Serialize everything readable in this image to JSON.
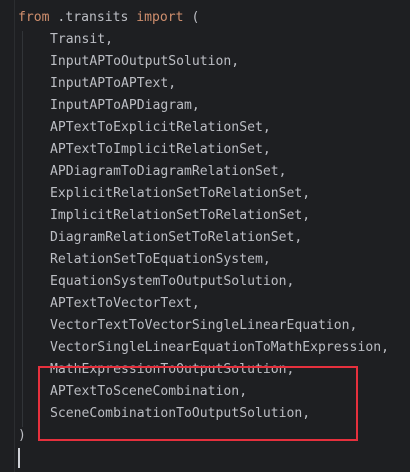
{
  "editor": {
    "import_line": {
      "keyword_from": "from",
      "module": " .transits ",
      "keyword_import": "import",
      "open_paren": " ("
    },
    "items": [
      "Transit,",
      "InputAPToOutputSolution,",
      "InputAPToAPText,",
      "InputAPToAPDiagram,",
      "APTextToExplicitRelationSet,",
      "APTextToImplicitRelationSet,",
      "APDiagramToDiagramRelationSet,",
      "ExplicitRelationSetToRelationSet,",
      "ImplicitRelationSetToRelationSet,",
      "DiagramRelationSetToRelationSet,",
      "RelationSetToEquationSystem,",
      "EquationSystemToOutputSolution,",
      "APTextToVectorText,",
      "VectorTextToVectorSingleLinearEquation,",
      "VectorSingleLinearEquationToMathExpression,",
      "MathExpressionToOutputSolution,",
      "APTextToSceneCombination,",
      "SceneCombinationToOutputSolution,"
    ],
    "close_paren": ")",
    "highlight_color": "#e6303d",
    "keyword_color": "#cf8e6d",
    "text_color": "#bcbec4",
    "background_color": "#1e1f22"
  }
}
